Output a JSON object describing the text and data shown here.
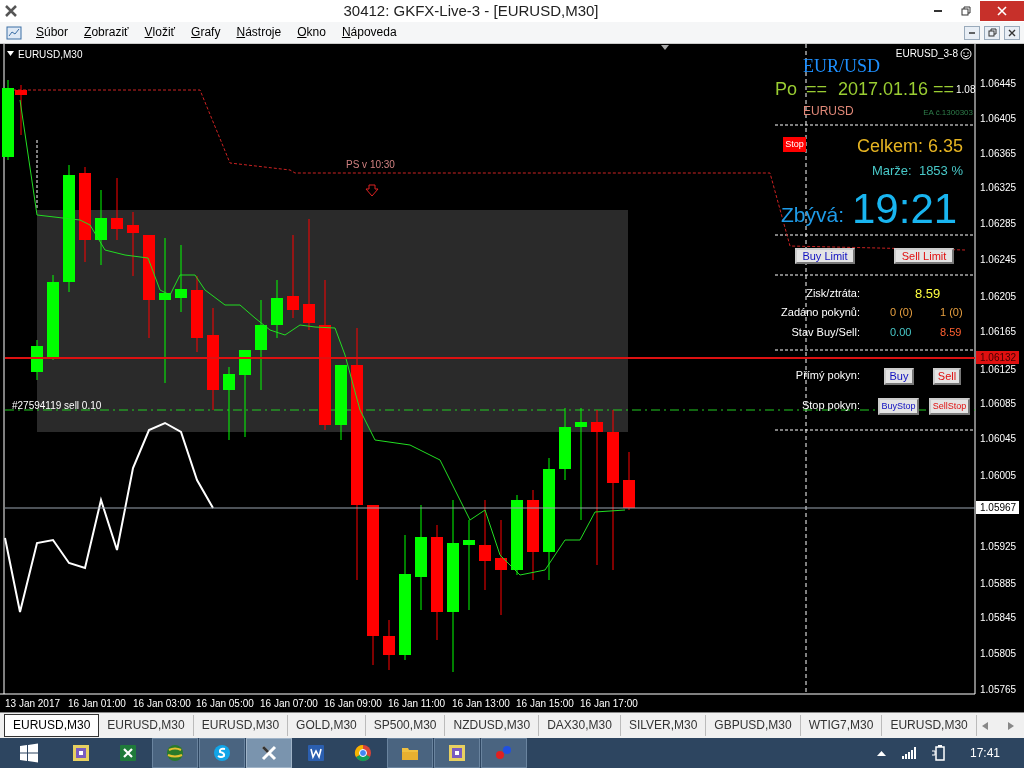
{
  "window": {
    "title": "30412: GKFX-Live-3 - [EURUSD,M30]"
  },
  "menu": [
    "Súbor",
    "Zobraziť",
    "Vložiť",
    "Grafy",
    "Nástroje",
    "Okno",
    "Nápoveda"
  ],
  "chart": {
    "title": "EURUSD,M30",
    "trade_label": "#27594119 sell 0.10",
    "session_label": "PS v 10:30",
    "price_ticks": [
      "1.06445",
      "1.06405",
      "1.06365",
      "1.06325",
      "1.06285",
      "1.06245",
      "1.06205",
      "1.06165",
      "1.06125",
      "1.06085",
      "1.06045",
      "1.06005",
      "1.05925",
      "1.05885",
      "1.05845",
      "1.05805",
      "1.05765"
    ],
    "price_line": "1.06132",
    "bid_label": "1.05967",
    "time_ticks": [
      "13 Jan 2017",
      "16 Jan 01:00",
      "16 Jan 03:00",
      "16 Jan 05:00",
      "16 Jan 07:00",
      "16 Jan 09:00",
      "16 Jan 11:00",
      "16 Jan 13:00",
      "16 Jan 15:00",
      "16 Jan 17:00"
    ]
  },
  "panel": {
    "expert": "EURUSD_3-8",
    "pair": "EUR/USD",
    "day": "Po",
    "date_prefix": "==",
    "date": "2017.01.16",
    "date_suffix": "==",
    "version": "1.08",
    "symbol": "EURUSD",
    "ea": "EA č.1300303",
    "stop_button": "Stop",
    "total": "Celkem: 6.35",
    "margin": "Marže:  1853 %",
    "remaining_label": "Zbývá:",
    "remaining": "19:21",
    "limit_buttons": [
      "Buy Limit",
      "Sell Limit"
    ],
    "stats": [
      {
        "label": "Zisk/ztráta:",
        "values": [
          "8.59"
        ]
      },
      {
        "label": "Zadáno pokynů:",
        "values": [
          "0 (0)",
          "1 (0)"
        ]
      },
      {
        "label": "Stav Buy/Sell:",
        "values": [
          "0.00",
          "8.59"
        ]
      }
    ],
    "orders": [
      {
        "label": "Přímý pokyn:",
        "buttons": [
          "Buy",
          "Sell"
        ]
      },
      {
        "label": "Stop pokyn:",
        "buttons": [
          "BuyStop",
          "SellStop"
        ]
      }
    ]
  },
  "tabs": [
    {
      "label": "EURUSD,M30",
      "selected": true
    },
    {
      "label": "EURUSD,M30",
      "selected": false
    },
    {
      "label": "EURUSD,M30",
      "selected": false
    },
    {
      "label": "GOLD,M30",
      "selected": false
    },
    {
      "label": "SP500,M30",
      "selected": false
    },
    {
      "label": "NZDUSD,M30",
      "selected": false
    },
    {
      "label": "DAX30,M30",
      "selected": false
    },
    {
      "label": "SILVER,M30",
      "selected": false
    },
    {
      "label": "GBPUSD,M30",
      "selected": false
    },
    {
      "label": "WTIG7,M30",
      "selected": false
    },
    {
      "label": "EURUSD,M30",
      "selected": false
    }
  ],
  "taskbar": {
    "apps": [
      {
        "running": false,
        "selected": false
      },
      {
        "running": false,
        "selected": false
      },
      {
        "running": true,
        "selected": false
      },
      {
        "running": true,
        "selected": false
      },
      {
        "running": true,
        "selected": true
      },
      {
        "running": false,
        "selected": false
      },
      {
        "running": false,
        "selected": false
      },
      {
        "running": true,
        "selected": false
      },
      {
        "running": true,
        "selected": false
      },
      {
        "running": true,
        "selected": false
      }
    ],
    "clock": "17:41"
  }
}
